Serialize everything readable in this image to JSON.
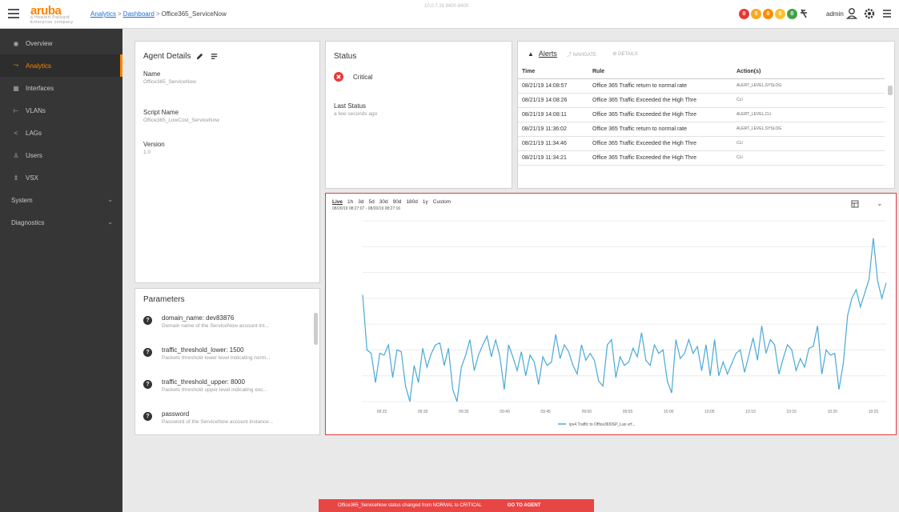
{
  "header": {
    "brand": "aruba",
    "brand_sub": "a Hewlett Packard Enterprise company",
    "breadcrumb": [
      "Analytics",
      "Dashboard",
      "Office365_ServiceNow"
    ],
    "ip": "10.0.7.18  8400 8400",
    "status_counts": [
      {
        "value": "0",
        "color": "#e53935"
      },
      {
        "value": "0",
        "color": "#f9a825"
      },
      {
        "value": "0",
        "color": "#fb8c00"
      },
      {
        "value": "0",
        "color": "#fbc02d"
      },
      {
        "value": "0",
        "color": "#43a047"
      }
    ],
    "user": "admin"
  },
  "sidebar": {
    "items": [
      {
        "icon": "overview-icon",
        "label": "Overview"
      },
      {
        "icon": "analytics-icon",
        "label": "Analytics",
        "active": true
      },
      {
        "icon": "interfaces-icon",
        "label": "Interfaces"
      },
      {
        "icon": "vlans-icon",
        "label": "VLANs"
      },
      {
        "icon": "lags-icon",
        "label": "LAGs"
      },
      {
        "icon": "users-icon",
        "label": "Users"
      },
      {
        "icon": "vsx-icon",
        "label": "VSX"
      },
      {
        "icon": "",
        "label": "System",
        "caret": true
      },
      {
        "icon": "",
        "label": "Diagnostics",
        "caret": true
      }
    ]
  },
  "agent_details": {
    "title": "Agent Details",
    "name_label": "Name",
    "name_value": "Office365_ServiceNow",
    "script_label": "Script Name",
    "script_value": "Office365_LowCost_ServiceNow",
    "version_label": "Version",
    "version_value": "1.0"
  },
  "status": {
    "title": "Status",
    "state": "Critical",
    "last_label": "Last Status",
    "last_value": "a few seconds ago"
  },
  "alerts": {
    "title": "Alerts",
    "tab2": "NAVIGATE",
    "tab3": "DETAILS",
    "columns": [
      "Time",
      "Rule",
      "Action(s)"
    ],
    "rows": [
      [
        "08/21/19 14:08:57",
        "Office 365 Traffic return to normal rate",
        "ALERT_LEVEL,SYSLOG"
      ],
      [
        "08/21/19 14:08:26",
        "Office 365 Traffic Exceeded the High Thre",
        "CLI"
      ],
      [
        "08/21/19 14:08:11",
        "Office 365 Traffic Exceeded the High Thre",
        "ALERT_LEVEL,CLI"
      ],
      [
        "08/21/19 11:36:02",
        "Office 365 Traffic return to normal rate",
        "ALERT_LEVEL,SYSLOG"
      ],
      [
        "08/21/19 11:34:46",
        "Office 365 Traffic Exceeded the High Thre",
        "CLI"
      ],
      [
        "08/21/19 11:34:21",
        "Office 365 Traffic Exceeded the High Thre",
        "CLI"
      ]
    ]
  },
  "chart": {
    "zoom_label": "Live",
    "zoom_options": [
      "1h",
      "3d",
      "5d",
      "30d",
      "90d",
      "180d",
      "1y",
      "Custom"
    ],
    "date_range": "08/20/19 08:27:07 - 08/20/19 08:27:16",
    "legend": "ipv4 Traffic to Office365ISP_Lan vrf..."
  },
  "chart_data": {
    "type": "line",
    "title": "",
    "ylabel": "",
    "xlabel": "",
    "x": [
      "09:25",
      "09:30",
      "09:35",
      "09:40",
      "09:45",
      "09:50",
      "09:55",
      "10:00",
      "10:05",
      "10:10",
      "10:15",
      "10:20",
      "10:25"
    ],
    "series": [
      {
        "name": "ipv4 Traffic to Office365ISP_Lan vrf...",
        "color": "#4aa8d8",
        "values": [
          1240,
          600,
          560,
          220,
          560,
          540,
          660,
          280,
          600,
          580,
          180,
          0,
          420,
          220,
          620,
          400,
          560,
          660,
          680,
          420,
          620,
          140,
          0,
          400,
          540,
          720,
          360,
          540,
          660,
          760,
          520,
          720,
          520,
          140,
          660,
          520,
          360,
          580,
          300,
          540,
          460,
          200,
          520,
          420,
          460,
          780,
          500,
          660,
          580,
          420,
          320,
          660,
          480,
          560,
          480,
          240,
          180,
          660,
          720,
          280,
          520,
          420,
          460,
          620,
          520,
          800,
          480,
          420,
          660,
          560,
          600,
          240,
          100,
          720,
          500,
          560,
          720,
          560,
          640,
          360,
          660,
          300,
          720,
          300,
          460,
          320,
          440,
          560,
          600,
          340,
          540,
          740,
          480,
          880,
          560,
          720,
          660,
          320,
          500,
          660,
          600,
          360,
          500,
          400,
          620,
          640,
          880,
          320,
          600,
          540,
          560,
          140,
          440,
          1000,
          1200,
          1300,
          1100,
          1260,
          1420,
          1900,
          1400,
          1200,
          1380
        ]
      }
    ],
    "ylim": [
      0,
      2100
    ],
    "grid": true
  },
  "parameters": {
    "title": "Parameters",
    "items": [
      {
        "name": "domain_name: dev83876",
        "desc": "Domain name of the ServiceNow account int..."
      },
      {
        "name": "traffic_threshold_lower: 1500",
        "desc": "Packets threshold lower level indicating norm..."
      },
      {
        "name": "traffic_threshold_upper: 8000",
        "desc": "Packets threshold upper level indicating exc..."
      },
      {
        "name": "password",
        "desc": "Password of the ServiceNow account instance..."
      }
    ]
  },
  "toast": {
    "message": "Office365_ServiceNow status changed from NORMAL to CRITICAL",
    "action": "GO TO AGENT"
  }
}
